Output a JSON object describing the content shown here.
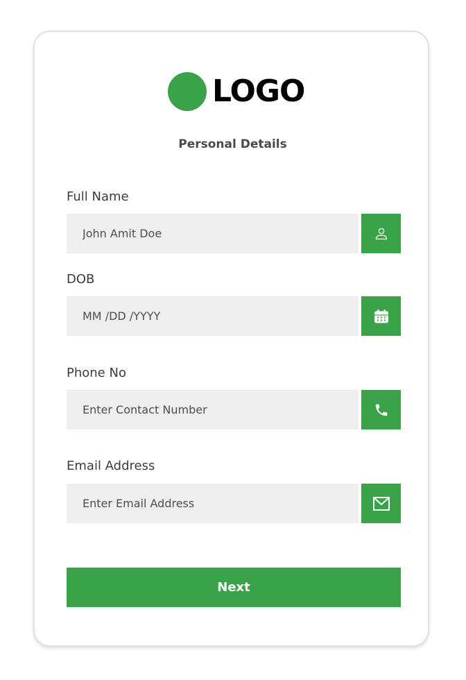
{
  "logo": {
    "text": "LOGO"
  },
  "form": {
    "title": "Personal Details",
    "fields": [
      {
        "label": "Full Name",
        "value": "John Amit Doe",
        "placeholder": "",
        "icon": "user-icon"
      },
      {
        "label": "DOB",
        "value": "",
        "placeholder": "MM /DD /YYYY",
        "icon": "calendar-icon"
      },
      {
        "label": "Phone No",
        "value": "",
        "placeholder": "Enter Contact Number",
        "icon": "phone-icon"
      },
      {
        "label": "Email Address",
        "value": "",
        "placeholder": "Enter Email Address",
        "icon": "mail-icon"
      }
    ],
    "next_label": "Next"
  },
  "colors": {
    "accent": "#3aa34a",
    "field_bg": "#eeeeee"
  }
}
